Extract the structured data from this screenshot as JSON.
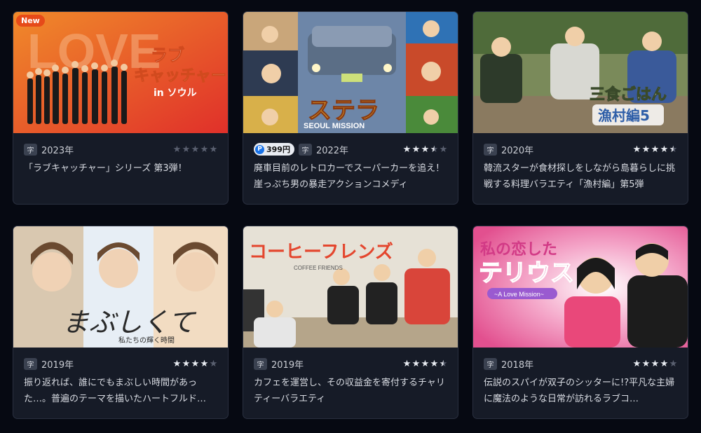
{
  "cards": [
    {
      "new_badge": "New",
      "sub_badge": "字",
      "year": "2023年",
      "price": "",
      "rating": 0,
      "thumb_title": "ラブ キャッチャー",
      "thumb_sub": "in ソウル",
      "description": "「ラブキャッチャー」シリーズ 第3弾！"
    },
    {
      "new_badge": "",
      "sub_badge": "字",
      "year": "2022年",
      "price": "399円",
      "price_icon": "P",
      "rating": 3.5,
      "thumb_title": "ステラ",
      "thumb_sub": "SEOUL MISSION",
      "description": "廃車目前のレトロカーでスーパーカーを追え！崖っぷち男の暴走アクションコメディ"
    },
    {
      "new_badge": "",
      "sub_badge": "字",
      "year": "2020年",
      "price": "",
      "rating": 4.5,
      "thumb_title": "三食ごはん",
      "thumb_sub": "漁村編5",
      "description": "韓流スターが食材探しをしながら島暮らしに挑戦する料理バラエティ「漁村編」第5弾"
    },
    {
      "new_badge": "",
      "sub_badge": "字",
      "year": "2019年",
      "price": "",
      "rating": 4,
      "thumb_title": "まぶしくて",
      "thumb_sub": "私たちの輝く時間",
      "description": "振り返れば、誰にでもまぶしい時間があった…。普遍のテーマを描いたハートフルド…"
    },
    {
      "new_badge": "",
      "sub_badge": "字",
      "year": "2019年",
      "price": "",
      "rating": 4.5,
      "thumb_title": "コーヒーフレンズ",
      "thumb_sub": "COFFEE FRIENDS",
      "description": "カフェを運営し、その収益金を寄付するチャリティーバラエティ"
    },
    {
      "new_badge": "",
      "sub_badge": "字",
      "year": "2018年",
      "price": "",
      "rating": 4,
      "thumb_title": "私の恋したテリウス",
      "thumb_sub": "~A Love Mission~",
      "description": "伝説のスパイが双子のシッターに!?平凡な主婦に魔法のような日常が訪れるラブコ…"
    }
  ]
}
